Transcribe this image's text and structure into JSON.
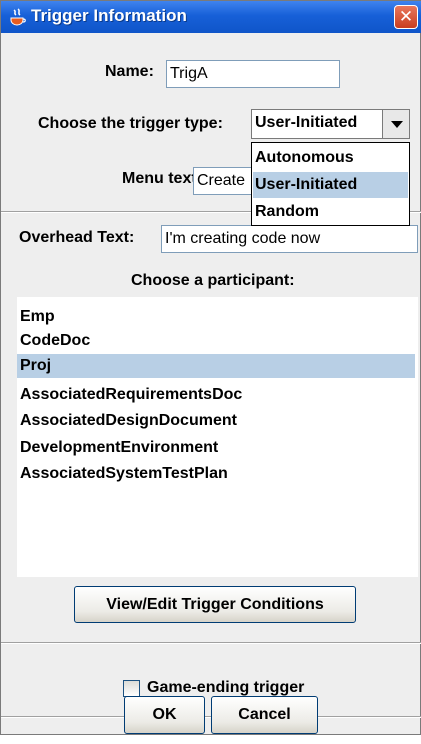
{
  "window": {
    "title": "Trigger Information",
    "close_glyph": "✕"
  },
  "form": {
    "name_label": "Name:",
    "name_value": "TrigA",
    "type_label": "Choose the trigger type:",
    "type_selected": "User-Initiated",
    "type_options": [
      "Autonomous",
      "User-Initiated",
      "Random"
    ],
    "menu_text_label": "Menu text:",
    "menu_text_value": "Create",
    "overhead_label": "Overhead Text:",
    "overhead_value": "I'm creating code now",
    "participant_label": "Choose a participant:"
  },
  "participants": {
    "items": [
      "Emp",
      "CodeDoc",
      "Proj",
      "AssociatedRequirementsDoc",
      "AssociatedDesignDocument",
      "DevelopmentEnvironment",
      "AssociatedSystemTestPlan"
    ],
    "selected": "Proj"
  },
  "buttons": {
    "view_edit": "View/Edit Trigger Conditions",
    "game_ending": "Game-ending trigger",
    "ok": "OK",
    "cancel": "Cancel"
  },
  "colors": {
    "titlebar": "#1760d8",
    "selection": "#b8cfe5",
    "window_bg": "#eeeeee"
  }
}
